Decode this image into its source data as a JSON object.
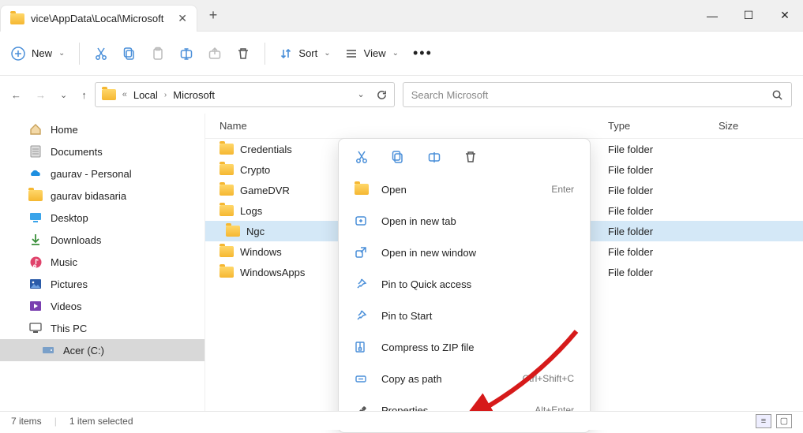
{
  "tab": {
    "title": "vice\\AppData\\Local\\Microsoft"
  },
  "toolbar": {
    "new_label": "New",
    "sort_label": "Sort",
    "view_label": "View"
  },
  "breadcrumb": {
    "items": [
      "Local",
      "Microsoft"
    ]
  },
  "search": {
    "placeholder": "Search Microsoft"
  },
  "columns": {
    "name": "Name",
    "type": "Type",
    "size": "Size"
  },
  "sidebar": {
    "items": [
      {
        "label": "Home",
        "icon": "home"
      },
      {
        "label": "Documents",
        "icon": "doc"
      },
      {
        "label": "gaurav - Personal",
        "icon": "onedrive"
      },
      {
        "label": "gaurav bidasaria",
        "icon": "folder"
      },
      {
        "label": "Desktop",
        "icon": "desktop"
      },
      {
        "label": "Downloads",
        "icon": "download"
      },
      {
        "label": "Music",
        "icon": "music"
      },
      {
        "label": "Pictures",
        "icon": "pictures"
      },
      {
        "label": "Videos",
        "icon": "videos"
      },
      {
        "label": "This PC",
        "icon": "pc"
      },
      {
        "label": "Acer (C:)",
        "icon": "drive",
        "selected": true,
        "indent": true
      }
    ]
  },
  "files": [
    {
      "name": "Credentials",
      "type": "File folder"
    },
    {
      "name": "Crypto",
      "type": "File folder"
    },
    {
      "name": "GameDVR",
      "type": "File folder"
    },
    {
      "name": "Logs",
      "type": "File folder"
    },
    {
      "name": "Ngc",
      "type": "File folder",
      "selected": true
    },
    {
      "name": "Windows",
      "type": "File folder"
    },
    {
      "name": "WindowsApps",
      "type": "File folder"
    }
  ],
  "context_menu": {
    "items": [
      {
        "label": "Open",
        "accel": "Enter",
        "icon": "open"
      },
      {
        "label": "Open in new tab",
        "accel": "",
        "icon": "newtab"
      },
      {
        "label": "Open in new window",
        "accel": "",
        "icon": "newwin"
      },
      {
        "label": "Pin to Quick access",
        "accel": "",
        "icon": "pin"
      },
      {
        "label": "Pin to Start",
        "accel": "",
        "icon": "pin"
      },
      {
        "label": "Compress to ZIP file",
        "accel": "",
        "icon": "zip"
      },
      {
        "label": "Copy as path",
        "accel": "Ctrl+Shift+C",
        "icon": "copypath"
      },
      {
        "label": "Properties",
        "accel": "Alt+Enter",
        "icon": "wrench"
      }
    ]
  },
  "status": {
    "count": "7 items",
    "selection": "1 item selected"
  }
}
